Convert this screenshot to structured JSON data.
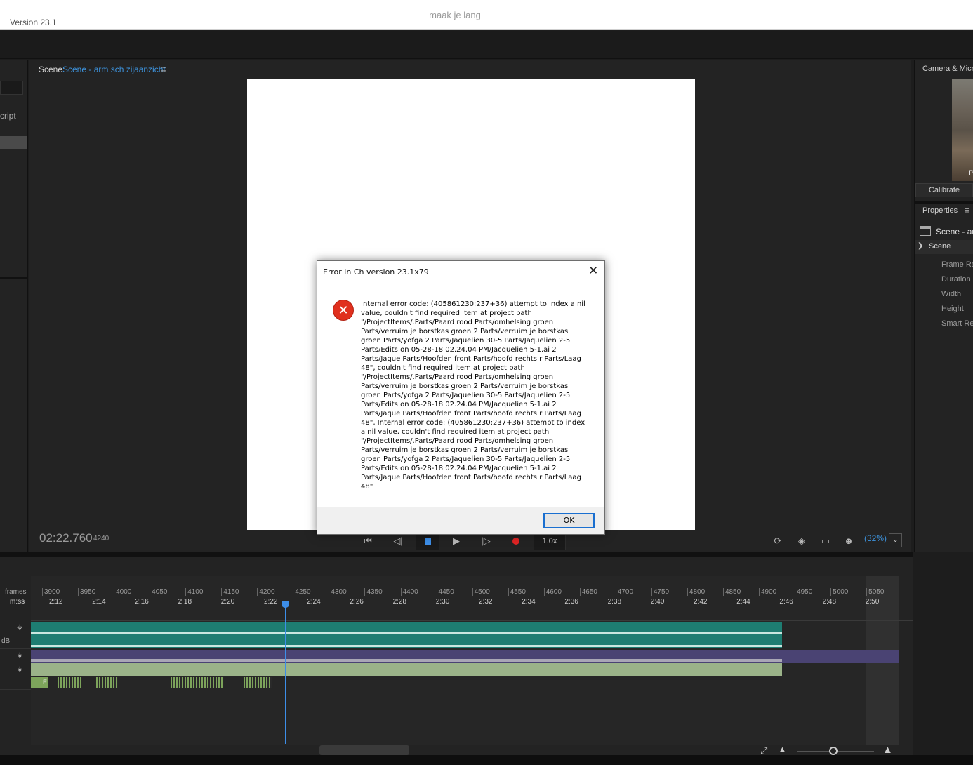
{
  "app": {
    "version": "Version 23.1",
    "document_title": "maak je lang"
  },
  "left_panel": {
    "script_label": "cript"
  },
  "scene_panel": {
    "label": "Scene:",
    "scene_name": "Scene - arm sch zijaanzicht",
    "menu_icon": "hamburger-menu-icon",
    "time": "02:22.760",
    "frame": "4240",
    "transport": {
      "first_frame_icon": "⏮",
      "prev_frame_icon": "◁|",
      "stop_icon": "stop-icon",
      "play_icon": "▶",
      "next_frame_icon": "|▷",
      "record_icon": "record-icon",
      "speed": "1.0x"
    },
    "zoom": "(32%)",
    "zoom_dropdown": "⌄"
  },
  "camera_panel": {
    "title": "Camera & Micr",
    "feed_letter": "P",
    "calibrate_label": "Calibrate"
  },
  "properties_panel": {
    "title": "Properties",
    "menu_icon": "≡",
    "scene_name": "Scene - ar",
    "section": "Scene",
    "rows": [
      "Frame Ra",
      "Duration",
      "Width",
      "Height",
      "Smart Re"
    ]
  },
  "timeline": {
    "frames_label": "frames",
    "mss_label": "m:ss",
    "db_label": "dB",
    "frame_ticks": [
      "3900",
      "3950",
      "4000",
      "4050",
      "4100",
      "4150",
      "4200",
      "4250",
      "4300",
      "4350",
      "4400",
      "4450",
      "4500",
      "4550",
      "4600",
      "4650",
      "4700",
      "4750",
      "4800",
      "4850",
      "4900",
      "4950",
      "5000",
      "5050"
    ],
    "time_ticks": [
      "2:12",
      "2:14",
      "2:16",
      "2:18",
      "2:20",
      "2:22",
      "2:24",
      "2:26",
      "2:28",
      "2:30",
      "2:32",
      "2:34",
      "2:36",
      "2:38",
      "2:40",
      "2:42",
      "2:44",
      "2:46",
      "2:48",
      "2:50"
    ],
    "marker_label": "E"
  },
  "dialog": {
    "title": "Error in Ch version 23.1x79",
    "close_icon": "✕",
    "error_icon": "error-x-icon",
    "message": "Internal error code: (405861230:237+36) attempt to index a nil value, couldn't find required item at project path \"/ProjectItems/.Parts/Paard rood Parts/omhelsing groen Parts/verruim je borstkas groen 2 Parts/verruim je borstkas groen Parts/yofga 2 Parts/Jaquelien 30-5 Parts/Jaquelien 2-5 Parts/Edits on 05-28-18 02.24.04 PM/Jacquelien 5-1.ai 2 Parts/Jaque Parts/Hoofden front Parts/hoofd rechts r Parts/Laag 48\", couldn't find required item at project path \"/ProjectItems/.Parts/Paard rood Parts/omhelsing groen Parts/verruim je borstkas groen 2 Parts/verruim je borstkas groen Parts/yofga 2 Parts/Jaquelien 30-5 Parts/Jaquelien 2-5 Parts/Edits on 05-28-18 02.24.04 PM/Jacquelien 5-1.ai 2 Parts/Jaque Parts/Hoofden front Parts/hoofd rechts r Parts/Laag 48\", Internal error code: (405861230:237+36) attempt to index a nil value, couldn't find required item at project path \"/ProjectItems/.Parts/Paard rood Parts/omhelsing groen Parts/verruim je borstkas groen 2 Parts/verruim je borstkas groen Parts/yofga 2 Parts/Jaquelien 30-5 Parts/Jaquelien 2-5 Parts/Edits on 05-28-18 02.24.04 PM/Jacquelien 5-1.ai 2 Parts/Jaque Parts/Hoofden front Parts/hoofd rechts r Parts/Laag 48\"",
    "ok_label": "OK"
  },
  "colors": {
    "accent": "#3d93dd",
    "record": "#e02424",
    "audio_track": "#1e7d72",
    "purple_track": "#4a4373",
    "green_track": "#9bb389",
    "error": "#e0301e"
  }
}
